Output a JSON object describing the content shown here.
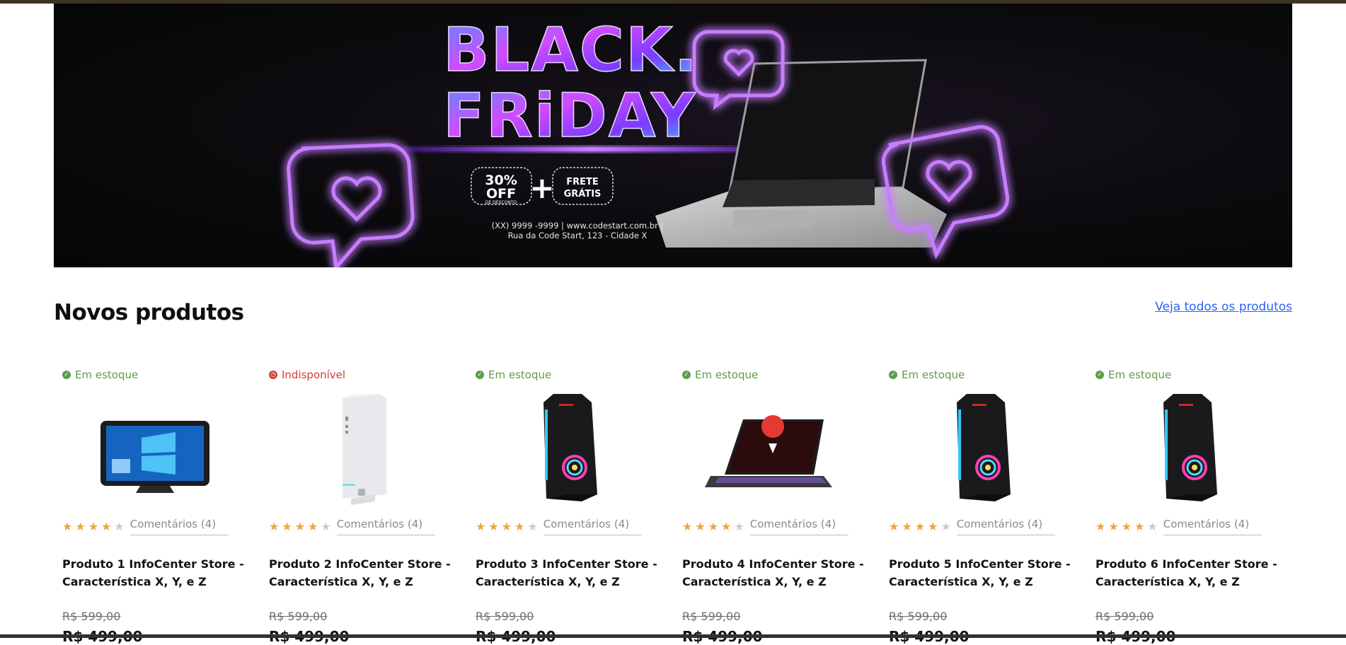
{
  "banner": {
    "headline_1": "BLACK.",
    "headline_2": "FRiDAY",
    "discount_big": "30%",
    "discount_off": "OFF",
    "discount_small": "DE DESCONTO",
    "plus": "+",
    "shipping_1": "FRETE",
    "shipping_2": "GRÁTIS",
    "contact_line_1": "(XX) 9999 -9999 | www.codestart.com.br  |",
    "contact_line_2": "Rua da Code Start, 123 - Cidade X"
  },
  "section": {
    "title": "Novos produtos",
    "see_all_link": "Veja todos os produtos"
  },
  "products": [
    {
      "stock": "Em estoque",
      "stock_status": "in",
      "image": "all-in-one-pc",
      "rating": 4,
      "reviews": "Comentários (4)",
      "name": "Produto 1 InfoCenter Store - Característica X, Y, e Z",
      "old_price": "R$ 599,00",
      "new_price": "R$ 499,00"
    },
    {
      "stock": "Indisponível",
      "stock_status": "out",
      "image": "white-desktop-tower",
      "rating": 4,
      "reviews": "Comentários (4)",
      "name": "Produto 2 InfoCenter Store - Característica X, Y, e Z",
      "old_price": "R$ 599,00",
      "new_price": "R$ 499,00"
    },
    {
      "stock": "Em estoque",
      "stock_status": "in",
      "image": "gaming-tower",
      "rating": 4,
      "reviews": "Comentários (4)",
      "name": "Produto 3 InfoCenter Store - Característica X, Y, e Z",
      "old_price": "R$ 599,00",
      "new_price": "R$ 499,00"
    },
    {
      "stock": "Em estoque",
      "stock_status": "in",
      "image": "gaming-laptop",
      "rating": 4,
      "reviews": "Comentários (4)",
      "name": "Produto 4 InfoCenter Store - Característica X, Y, e Z",
      "old_price": "R$ 599,00",
      "new_price": "R$ 499,00"
    },
    {
      "stock": "Em estoque",
      "stock_status": "in",
      "image": "gaming-tower",
      "rating": 4,
      "reviews": "Comentários (4)",
      "name": "Produto 5 InfoCenter Store - Característica X, Y, e Z",
      "old_price": "R$ 599,00",
      "new_price": "R$ 499,00"
    },
    {
      "stock": "Em estoque",
      "stock_status": "in",
      "image": "gaming-tower",
      "rating": 4,
      "reviews": "Comentários (4)",
      "name": "Produto 6 InfoCenter Store - Característica X, Y, e Z",
      "old_price": "R$ 599,00",
      "new_price": "R$ 499,00"
    }
  ],
  "colors": {
    "in_stock": "#5f9c47",
    "out_of_stock": "#d13d32",
    "star_on": "#f1a33c",
    "star_off": "#c6cbd6",
    "link": "#2962ff",
    "neon_purple": "#b347ff"
  }
}
